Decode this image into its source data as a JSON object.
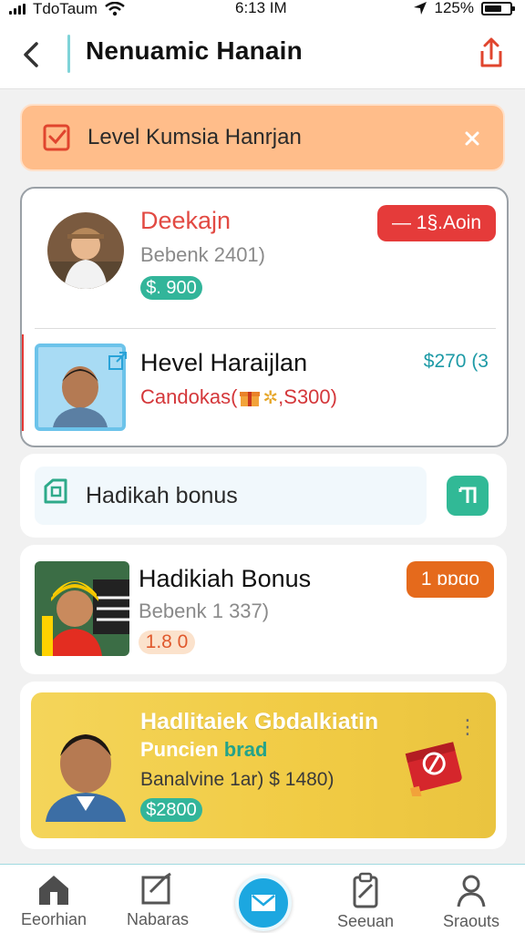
{
  "status_bar": {
    "carrier": "TdoTaum",
    "time": "6:13 IM",
    "battery": "125%"
  },
  "header": {
    "title": "Nenuamic Hanain"
  },
  "alert": {
    "text": "Level Kumsia Hanrjan"
  },
  "cards": {
    "deekajn": {
      "title": "Deekajn",
      "subtitle": "Bebenk 2401)",
      "price_pill": "$. 900",
      "action_badge": "— 1§.Aoin",
      "title_color": "#e24a43",
      "pill_color": "#32b59a",
      "badge_color": "#e53b3a"
    },
    "hevel": {
      "title": "Hevel Haraijlan",
      "subtitle": "Candokas(",
      "subtitle_tail": ",S300)",
      "price": "$270 (3",
      "subtitle_color": "#d4373a",
      "price_color": "#1d9aa6"
    },
    "bonus_row": {
      "label": "Hadikah bonus"
    },
    "hadikiah": {
      "title": "Hadikiah Bonus",
      "subtitle": "Bebenk 1 337)",
      "pill": "1.8 0",
      "badge": "1 ɒɒɑo",
      "badge_color": "#e56a1c",
      "pill_color": "#fbe2cc"
    },
    "promo": {
      "title": "Hadlitaiek Gbdalkiatin",
      "line2_a": "Puncien",
      "line2_b": "brad",
      "line3": "Banalvine 1ar) $ 1480)",
      "pill": "$2800",
      "pill_color": "#32b59a"
    }
  },
  "bottom_nav": {
    "items": [
      {
        "label": "Eeorhian",
        "icon": "home-icon"
      },
      {
        "label": "Nabaras",
        "icon": "edit-checkbox-icon"
      },
      {
        "label": "",
        "icon": "mail-icon"
      },
      {
        "label": "Seeuan",
        "icon": "clipboard-icon"
      },
      {
        "label": "Sraouts",
        "icon": "person-icon"
      }
    ]
  }
}
